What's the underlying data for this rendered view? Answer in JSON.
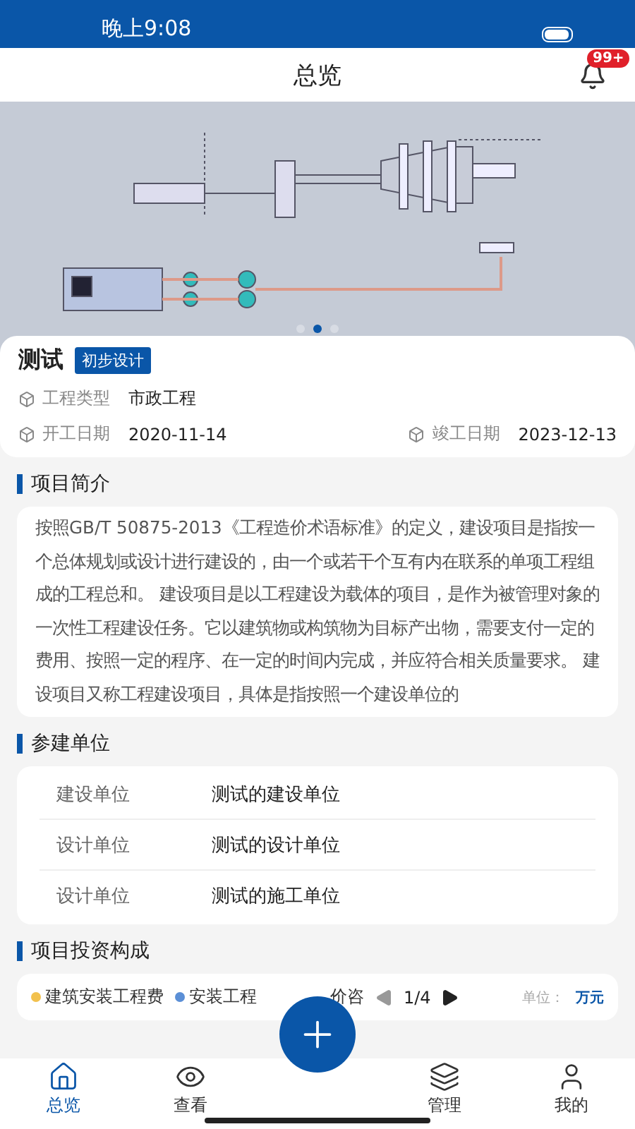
{
  "status_bar": {
    "time": "晚上9:08"
  },
  "header": {
    "title": "总览",
    "badge": "99+"
  },
  "banner": {
    "dots": [
      {
        "selected": false
      },
      {
        "selected": true
      },
      {
        "selected": false
      }
    ]
  },
  "project": {
    "name": "测试",
    "stage": "初步设计",
    "type_label": "工程类型",
    "type": "市政工程",
    "start_label": "开工日期",
    "start": "2020-11-14",
    "end_label": "竣工日期",
    "end": "2023-12-13"
  },
  "intro": {
    "title": "项目简介",
    "text": "按照GB/T 50875-2013《工程造价术语标准》的定义，建设项目是指按一个总体规划或设计进行建设的，由一个或若干个互有内在联系的单项工程组成的工程总和。 建设项目是以工程建设为载体的项目，是作为被管理对象的一次性工程建设任务。它以建筑物或构筑物为目标产出物，需要支付一定的费用、按照一定的程序、在一定的时间内完成，并应符合相关质量要求。 建设项目又称工程建设项目，具体是指按照一个建设单位的"
  },
  "units": {
    "title": "参建单位",
    "rows": [
      {
        "label": "建设单位",
        "value": "测试的建设单位"
      },
      {
        "label": "设计单位",
        "value": "测试的设计单位"
      },
      {
        "label": "设计单位",
        "value": "测试的施工单位"
      }
    ]
  },
  "investment": {
    "title": "项目投资构成",
    "legend": [
      {
        "label": "建筑安装工程费",
        "color": "#f2c14e"
      },
      {
        "label": "安装工程",
        "color": "#5b8fd6"
      },
      {
        "label": "价咨"
      }
    ],
    "page": "1/4",
    "unit_label": "单位：",
    "unit": "万元"
  },
  "nav": [
    {
      "label": "总览",
      "kind": "home",
      "selected": true
    },
    {
      "label": "查看",
      "kind": "eye",
      "selected": false
    },
    {
      "label": "管理",
      "kind": "layers",
      "selected": false
    },
    {
      "label": "我的",
      "kind": "user",
      "selected": false
    }
  ]
}
